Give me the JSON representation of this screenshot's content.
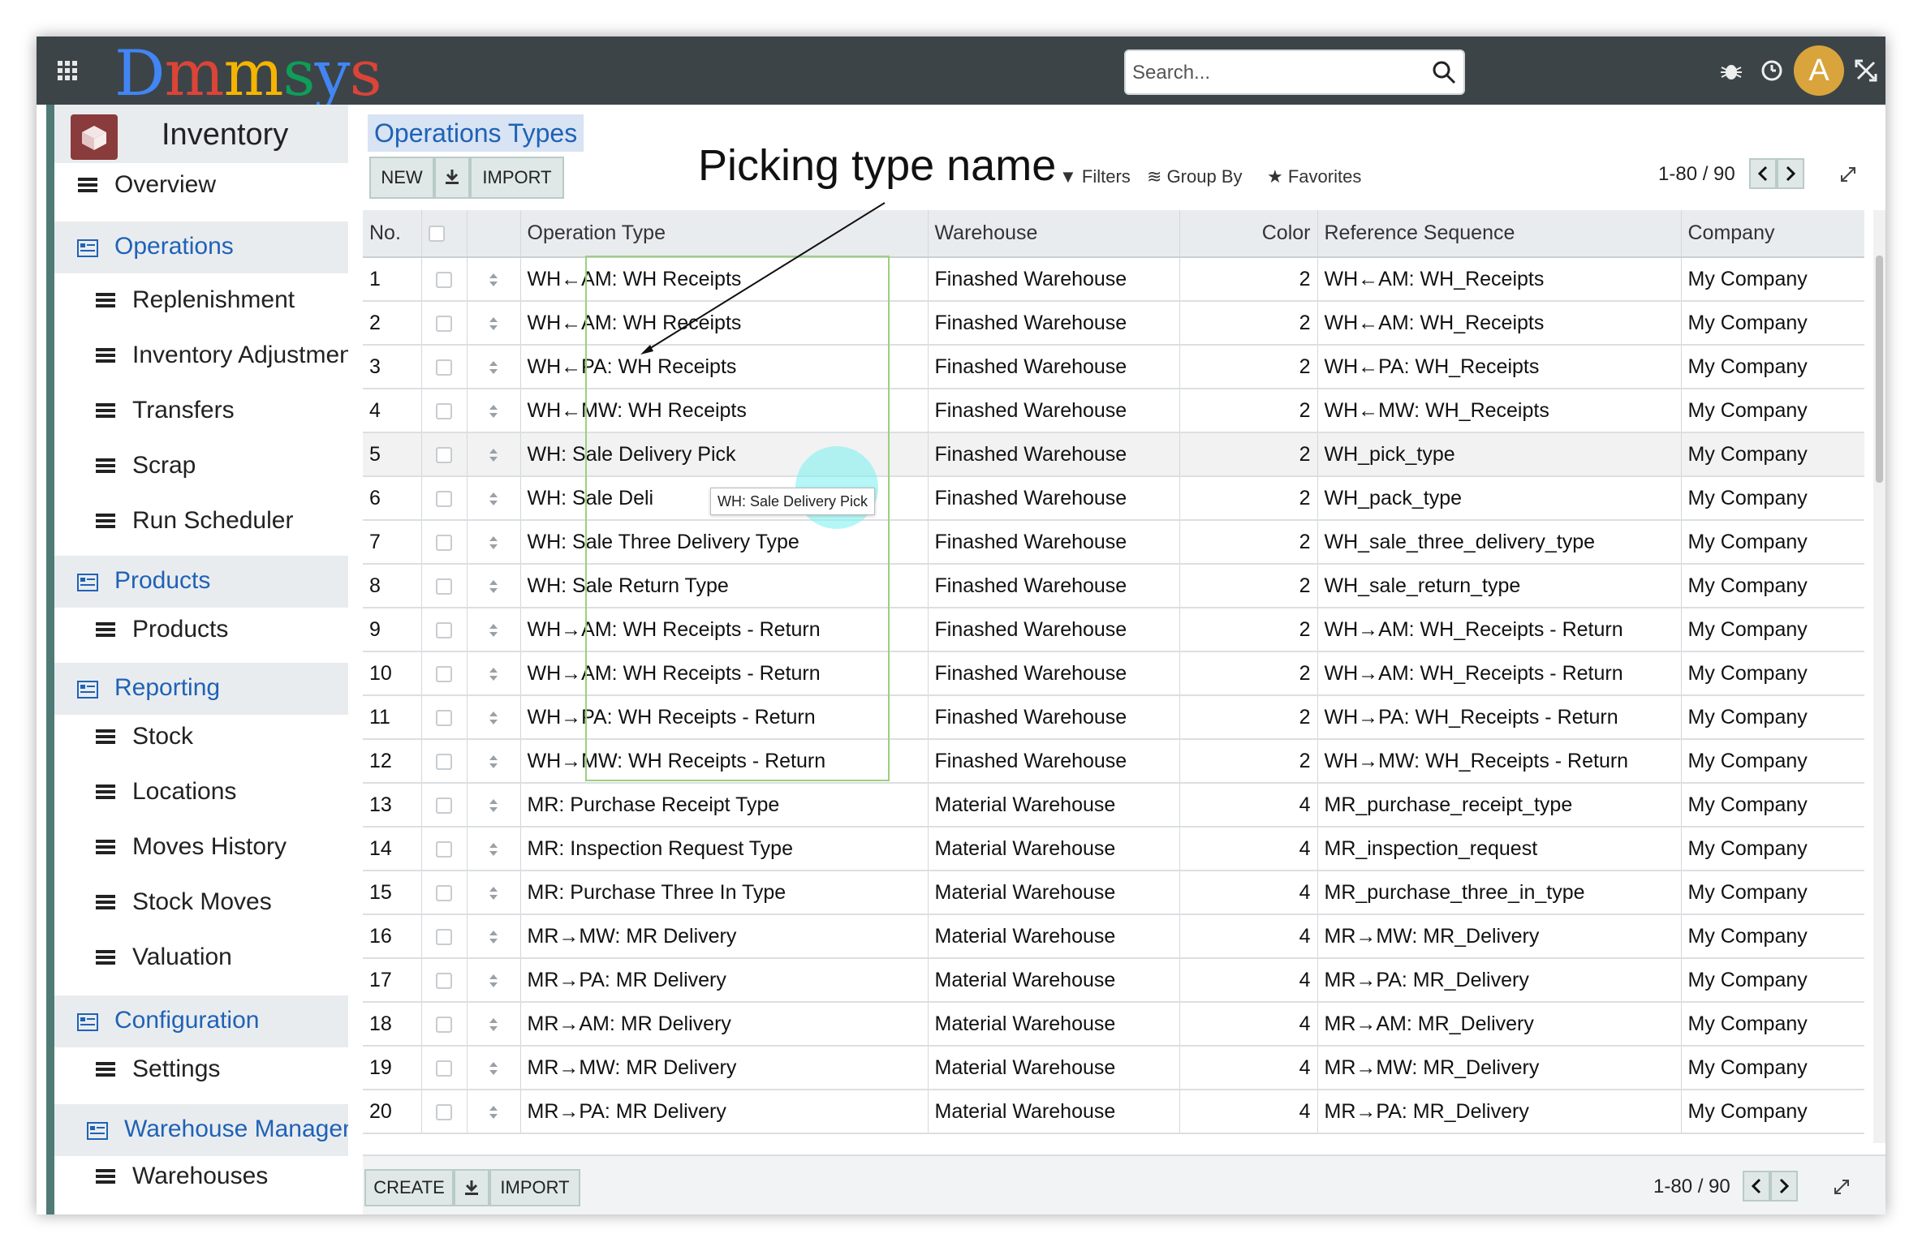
{
  "header": {
    "logo_text": [
      "D",
      "m",
      "m",
      "s",
      "y",
      "s"
    ],
    "search_placeholder": "Search...",
    "avatar_letter": "A"
  },
  "sidebar": {
    "app_label": "Inventory",
    "items": [
      {
        "label": "Overview",
        "group": false
      },
      {
        "label": "Operations",
        "group": true
      },
      {
        "label": "Replenishment",
        "group": false
      },
      {
        "label": "Inventory Adjustments",
        "group": false
      },
      {
        "label": "Transfers",
        "group": false
      },
      {
        "label": "Scrap",
        "group": false
      },
      {
        "label": "Run Scheduler",
        "group": false
      },
      {
        "label": "Products",
        "group": true
      },
      {
        "label": "Products",
        "group": false
      },
      {
        "label": "Reporting",
        "group": true
      },
      {
        "label": "Stock",
        "group": false
      },
      {
        "label": "Locations",
        "group": false
      },
      {
        "label": "Moves History",
        "group": false
      },
      {
        "label": "Stock Moves",
        "group": false
      },
      {
        "label": "Valuation",
        "group": false
      },
      {
        "label": "Configuration",
        "group": true
      },
      {
        "label": "Settings",
        "group": false
      },
      {
        "label": "Warehouse Management",
        "group": true
      },
      {
        "label": "Warehouses",
        "group": false
      }
    ]
  },
  "control": {
    "breadcrumb": "Operations Types",
    "new_label": "NEW",
    "import_label": "IMPORT",
    "filters_label": "Filters",
    "groupby_label": "Group By",
    "favorites_label": "Favorites",
    "pager": "1-80 / 90"
  },
  "annotation": {
    "title": "Picking type name",
    "tooltip": "WH: Sale Delivery Pick"
  },
  "table": {
    "columns": [
      "No.",
      "",
      "",
      "Operation Type",
      "Warehouse",
      "Color",
      "Reference Sequence",
      "Company"
    ],
    "rows": [
      [
        "1",
        "WH←AM: WH Receipts",
        "Finashed Warehouse",
        "2",
        "WH←AM: WH_Receipts",
        "My Company"
      ],
      [
        "2",
        "WH←AM: WH Receipts",
        "Finashed Warehouse",
        "2",
        "WH←AM: WH_Receipts",
        "My Company"
      ],
      [
        "3",
        "WH←PA: WH Receipts",
        "Finashed Warehouse",
        "2",
        "WH←PA: WH_Receipts",
        "My Company"
      ],
      [
        "4",
        "WH←MW: WH Receipts",
        "Finashed Warehouse",
        "2",
        "WH←MW: WH_Receipts",
        "My Company"
      ],
      [
        "5",
        "WH: Sale Delivery Pick",
        "Finashed Warehouse",
        "2",
        "WH_pick_type",
        "My Company"
      ],
      [
        "6",
        "WH: Sale Deli",
        "Finashed Warehouse",
        "2",
        "WH_pack_type",
        "My Company"
      ],
      [
        "7",
        "WH: Sale Three Delivery Type",
        "Finashed Warehouse",
        "2",
        "WH_sale_three_delivery_type",
        "My Company"
      ],
      [
        "8",
        "WH: Sale Return Type",
        "Finashed Warehouse",
        "2",
        "WH_sale_return_type",
        "My Company"
      ],
      [
        "9",
        "WH→AM: WH Receipts - Return",
        "Finashed Warehouse",
        "2",
        "WH→AM: WH_Receipts - Return",
        "My Company"
      ],
      [
        "10",
        "WH→AM: WH Receipts - Return",
        "Finashed Warehouse",
        "2",
        "WH→AM: WH_Receipts - Return",
        "My Company"
      ],
      [
        "11",
        "WH→PA: WH Receipts - Return",
        "Finashed Warehouse",
        "2",
        "WH→PA: WH_Receipts - Return",
        "My Company"
      ],
      [
        "12",
        "WH→MW: WH Receipts - Return",
        "Finashed Warehouse",
        "2",
        "WH→MW: WH_Receipts - Return",
        "My Company"
      ],
      [
        "13",
        "MR: Purchase Receipt Type",
        "Material Warehouse",
        "4",
        "MR_purchase_receipt_type",
        "My Company"
      ],
      [
        "14",
        "MR: Inspection Request Type",
        "Material Warehouse",
        "4",
        "MR_inspection_request",
        "My Company"
      ],
      [
        "15",
        "MR: Purchase Three In Type",
        "Material Warehouse",
        "4",
        "MR_purchase_three_in_type",
        "My Company"
      ],
      [
        "16",
        "MR→MW: MR Delivery",
        "Material Warehouse",
        "4",
        "MR→MW: MR_Delivery",
        "My Company"
      ],
      [
        "17",
        "MR→PA: MR Delivery",
        "Material Warehouse",
        "4",
        "MR→PA: MR_Delivery",
        "My Company"
      ],
      [
        "18",
        "MR→AM: MR Delivery",
        "Material Warehouse",
        "4",
        "MR→AM: MR_Delivery",
        "My Company"
      ],
      [
        "19",
        "MR→MW: MR Delivery",
        "Material Warehouse",
        "4",
        "MR→MW: MR_Delivery",
        "My Company"
      ],
      [
        "20",
        "MR→PA: MR Delivery",
        "Material Warehouse",
        "4",
        "MR→PA: MR_Delivery",
        "My Company"
      ]
    ]
  },
  "footer": {
    "create_label": "CREATE",
    "import_label": "IMPORT",
    "pager": "1-80 / 90"
  },
  "colors": {
    "topbar": "#3c4448",
    "accent": "#1f62b6",
    "highlight_box": "#9bd07e"
  }
}
